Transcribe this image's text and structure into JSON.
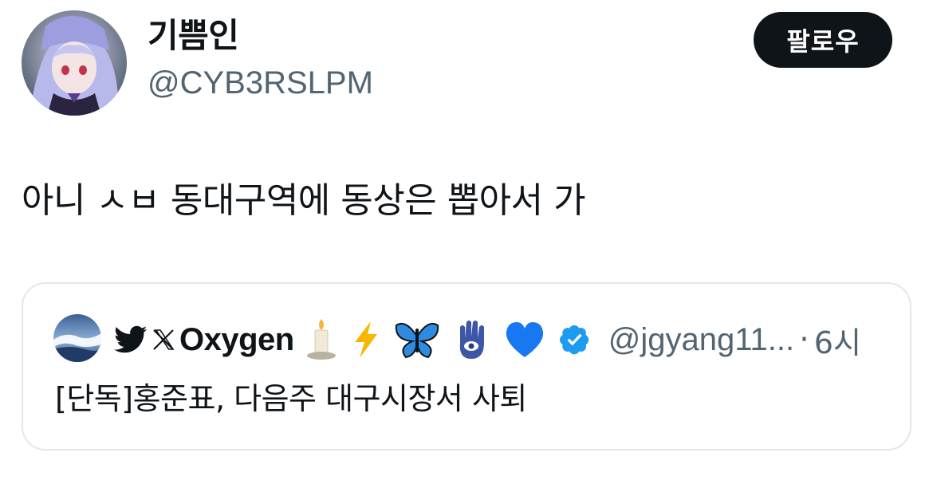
{
  "author": {
    "display_name": "기쁨인",
    "handle": "@CYB3RSLPM",
    "follow_label": "팔로우"
  },
  "tweet": {
    "text": "아니 ㅅㅂ 동대구역에 동상은 뽑아서 가"
  },
  "quote": {
    "name": "Oxygen",
    "name_icons": [
      "bird-icon",
      "x-logo-icon"
    ],
    "emojis": [
      "candle-icon",
      "lightning-icon",
      "butterfly-icon",
      "hamsa-icon",
      "blue-heart-icon"
    ],
    "verified": true,
    "handle": "@jgyang11...",
    "separator": "·",
    "time": "6시",
    "text": "[단독]홍준표, 다음주 대구시장서 사퇴"
  },
  "colors": {
    "text": "#0f1419",
    "secondary": "#536471",
    "follow_bg": "#0f1419",
    "verified": "#1d9bf0",
    "border": "#e3e7eb"
  }
}
